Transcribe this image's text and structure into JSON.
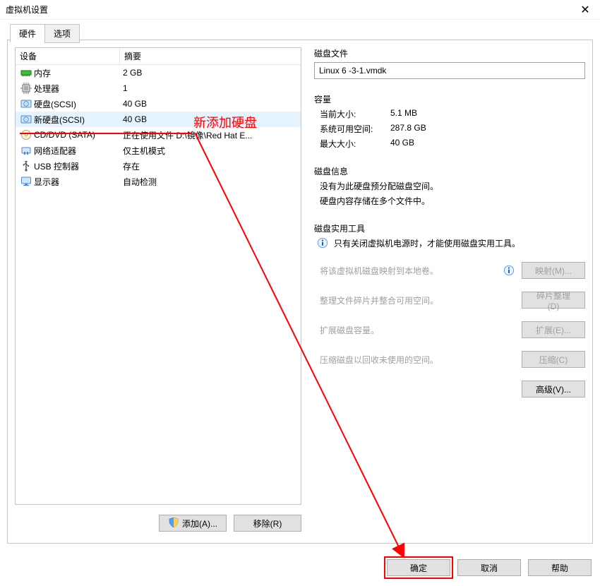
{
  "window": {
    "title": "虚拟机设置"
  },
  "tabs": {
    "hardware": "硬件",
    "options": "选项"
  },
  "hw_header": {
    "device": "设备",
    "summary": "摘要"
  },
  "hw_rows": [
    {
      "icon": "memory",
      "device": "内存",
      "summary": "2 GB"
    },
    {
      "icon": "cpu",
      "device": "处理器",
      "summary": "1"
    },
    {
      "icon": "disk",
      "device": "硬盘(SCSI)",
      "summary": "40 GB"
    },
    {
      "icon": "disk",
      "device": "新硬盘(SCSI)",
      "summary": "40 GB",
      "selected": true
    },
    {
      "icon": "cd",
      "device": "CD/DVD (SATA)",
      "summary": "正在使用文件 D:\\镜像\\Red Hat E..."
    },
    {
      "icon": "net",
      "device": "网络适配器",
      "summary": "仅主机模式"
    },
    {
      "icon": "usb",
      "device": "USB 控制器",
      "summary": "存在"
    },
    {
      "icon": "display",
      "device": "显示器",
      "summary": "自动检测"
    }
  ],
  "left_buttons": {
    "add": "添加(A)...",
    "remove": "移除(R)"
  },
  "right": {
    "disk_file_label": "磁盘文件",
    "disk_file_value": "Linux 6 -3-1.vmdk",
    "capacity_label": "容量",
    "current_size_lab": "当前大小:",
    "current_size_val": "5.1 MB",
    "sys_free_lab": "系统可用空间:",
    "sys_free_val": "287.8 GB",
    "max_size_lab": "最大大小:",
    "max_size_val": "40 GB",
    "disk_info_label": "磁盘信息",
    "disk_info_line1": "没有为此硬盘预分配磁盘空间。",
    "disk_info_line2": "硬盘内容存储在多个文件中。",
    "util_label": "磁盘实用工具",
    "util_note": "只有关闭虚拟机电源时，才能使用磁盘实用工具。",
    "util_map_text": "将该虚拟机磁盘映射到本地卷。",
    "util_map_btn": "映射(M)...",
    "util_defrag_text": "整理文件碎片并整合可用空间。",
    "util_defrag_btn": "碎片整理(D)",
    "util_expand_text": "扩展磁盘容量。",
    "util_expand_btn": "扩展(E)...",
    "util_compact_text": "压缩磁盘以回收未使用的空间。",
    "util_compact_btn": "压缩(C)",
    "advanced_btn": "高级(V)..."
  },
  "bottom": {
    "ok": "确定",
    "cancel": "取消",
    "help": "帮助"
  },
  "annotation": {
    "label": "新添加硬盘"
  }
}
